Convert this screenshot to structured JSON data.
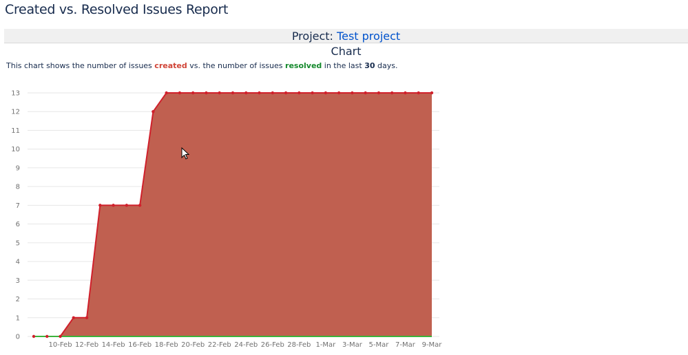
{
  "page": {
    "title": "Created vs. Resolved Issues Report",
    "project_label": "Project:",
    "project_name": "Test project",
    "chart_heading": "Chart"
  },
  "description": {
    "part1": "This chart shows the number of issues ",
    "created": "created",
    "part2": " vs. the number of issues ",
    "resolved": "resolved",
    "part3": " in the last ",
    "days": "30",
    "part4": " days."
  },
  "colors": {
    "created_line": "#d0202b",
    "created_fill": "#c06050",
    "resolved_line": "#3bb33b",
    "grid": "#e6e6e6"
  },
  "chart_data": {
    "type": "area",
    "title": "",
    "xlabel": "",
    "ylabel": "",
    "ylim": [
      0,
      13
    ],
    "y_ticks": [
      0,
      1,
      2,
      3,
      4,
      5,
      6,
      7,
      8,
      9,
      10,
      11,
      12,
      13
    ],
    "x": [
      "8-Feb",
      "9-Feb",
      "10-Feb",
      "11-Feb",
      "12-Feb",
      "13-Feb",
      "14-Feb",
      "15-Feb",
      "16-Feb",
      "17-Feb",
      "18-Feb",
      "19-Feb",
      "20-Feb",
      "21-Feb",
      "22-Feb",
      "23-Feb",
      "24-Feb",
      "25-Feb",
      "26-Feb",
      "27-Feb",
      "28-Feb",
      "29-Feb",
      "1-Mar",
      "2-Mar",
      "3-Mar",
      "4-Mar",
      "5-Mar",
      "6-Mar",
      "7-Mar",
      "8-Mar",
      "9-Mar"
    ],
    "x_tick_labels": [
      "10-Feb",
      "12-Feb",
      "14-Feb",
      "16-Feb",
      "18-Feb",
      "20-Feb",
      "22-Feb",
      "24-Feb",
      "26-Feb",
      "28-Feb",
      "1-Mar",
      "3-Mar",
      "5-Mar",
      "7-Mar",
      "9-Mar"
    ],
    "series": [
      {
        "name": "created",
        "values": [
          0,
          0,
          0,
          1,
          1,
          7,
          7,
          7,
          7,
          12,
          13,
          13,
          13,
          13,
          13,
          13,
          13,
          13,
          13,
          13,
          13,
          13,
          13,
          13,
          13,
          13,
          13,
          13,
          13,
          13,
          13
        ]
      },
      {
        "name": "resolved",
        "values": [
          0,
          0,
          0,
          0,
          0,
          0,
          0,
          0,
          0,
          0,
          0,
          0,
          0,
          0,
          0,
          0,
          0,
          0,
          0,
          0,
          0,
          0,
          0,
          0,
          0,
          0,
          0,
          0,
          0,
          0,
          0
        ]
      }
    ]
  }
}
